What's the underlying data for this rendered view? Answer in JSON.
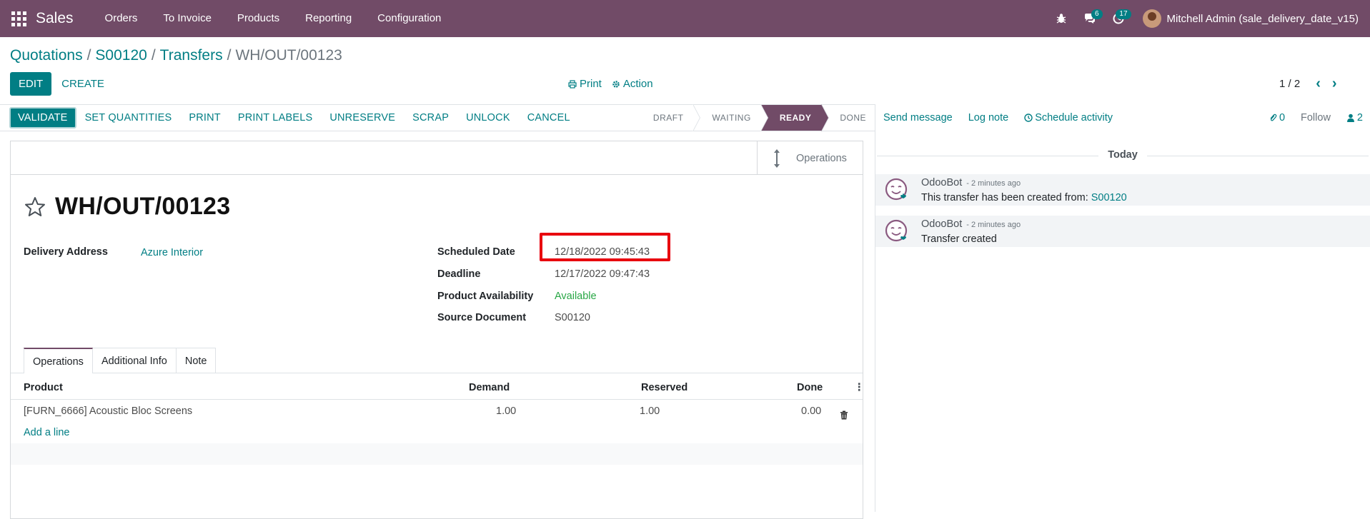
{
  "navbar": {
    "app_name": "Sales",
    "menu": [
      "Orders",
      "To Invoice",
      "Products",
      "Reporting",
      "Configuration"
    ],
    "messages_count": "6",
    "activities_count": "17",
    "user_name": "Mitchell Admin (sale_delivery_date_v15)"
  },
  "breadcrumb": {
    "items": [
      "Quotations",
      "S00120",
      "Transfers"
    ],
    "current": "WH/OUT/00123"
  },
  "control_panel": {
    "edit": "EDIT",
    "create": "CREATE",
    "print": "Print",
    "action": "Action",
    "pager": "1 / 2"
  },
  "statusbar": {
    "buttons": [
      "VALIDATE",
      "SET QUANTITIES",
      "PRINT",
      "PRINT LABELS",
      "UNRESERVE",
      "SCRAP",
      "UNLOCK",
      "CANCEL"
    ],
    "stages": [
      "DRAFT",
      "WAITING",
      "READY",
      "DONE"
    ],
    "active_stage": "READY"
  },
  "form": {
    "smart_button": "Operations",
    "title": "WH/OUT/00123",
    "delivery_address_label": "Delivery Address",
    "delivery_address": "Azure Interior",
    "scheduled_date_label": "Scheduled Date",
    "scheduled_date": "12/18/2022 09:45:43",
    "deadline_label": "Deadline",
    "deadline": "12/17/2022 09:47:43",
    "availability_label": "Product Availability",
    "availability": "Available",
    "source_label": "Source Document",
    "source": "S00120",
    "tabs": [
      "Operations",
      "Additional Info",
      "Note"
    ],
    "table": {
      "headers": [
        "Product",
        "Demand",
        "Reserved",
        "Done"
      ],
      "rows": [
        {
          "product": "[FURN_6666] Acoustic Bloc Screens",
          "demand": "1.00",
          "reserved": "1.00",
          "done": "0.00"
        }
      ],
      "add_line": "Add a line"
    }
  },
  "chatter": {
    "send_message": "Send message",
    "log_note": "Log note",
    "schedule_activity": "Schedule activity",
    "attachments": "0",
    "follow": "Follow",
    "followers": "2",
    "today": "Today",
    "messages": [
      {
        "author": "OdooBot",
        "time": "- 2 minutes ago",
        "body": "This transfer has been created from: ",
        "link": "S00120"
      },
      {
        "author": "OdooBot",
        "time": "- 2 minutes ago",
        "body": "Transfer created",
        "link": ""
      }
    ]
  },
  "colors": {
    "brand": "#714b67",
    "accent": "#017e84",
    "highlight": "#e8000e",
    "available": "#28a745"
  }
}
